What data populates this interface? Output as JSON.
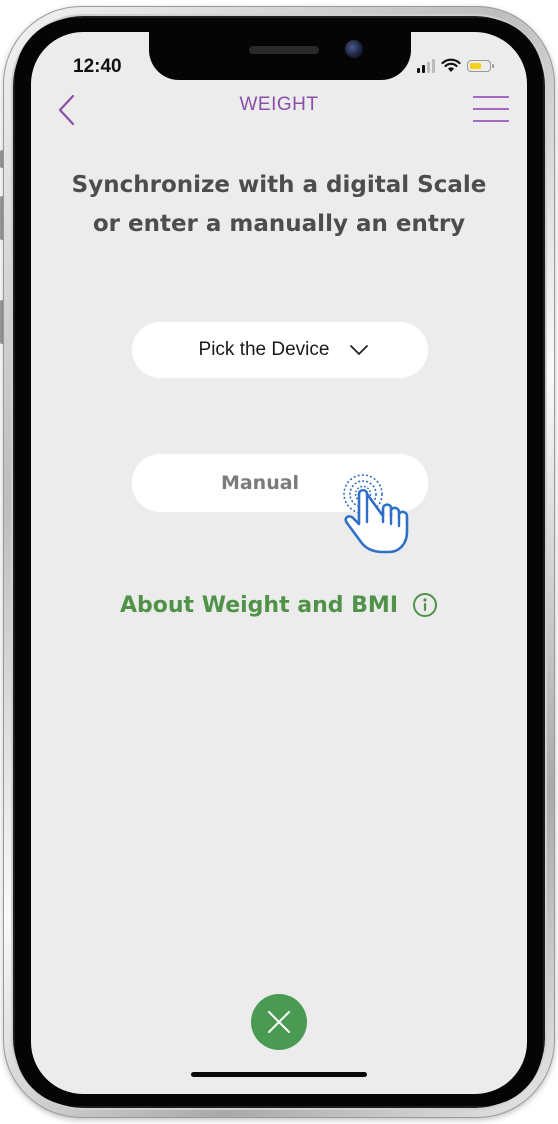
{
  "status_bar": {
    "time": "12:40",
    "icons": [
      "signal-icon",
      "wifi-icon",
      "battery-icon"
    ],
    "battery_color": "#f3d21a"
  },
  "nav": {
    "back_icon": "chevron-left-icon",
    "title": "WEIGHT",
    "menu_icon": "hamburger-menu-icon",
    "accent_color": "#8a4fa6"
  },
  "main": {
    "headline": "Synchronize with a digital Scale or enter a manually an entry",
    "device_picker": {
      "label": "Pick the Device",
      "icon": "chevron-down-icon"
    },
    "manual_button": {
      "label": "Manual",
      "overlay_icon": "tap-hand-icon"
    },
    "about_link": {
      "label": "About Weight and BMI",
      "icon": "info-icon",
      "color": "#4f9248"
    }
  },
  "footer": {
    "close_icon": "close-icon",
    "close_color": "#4b9a53"
  }
}
